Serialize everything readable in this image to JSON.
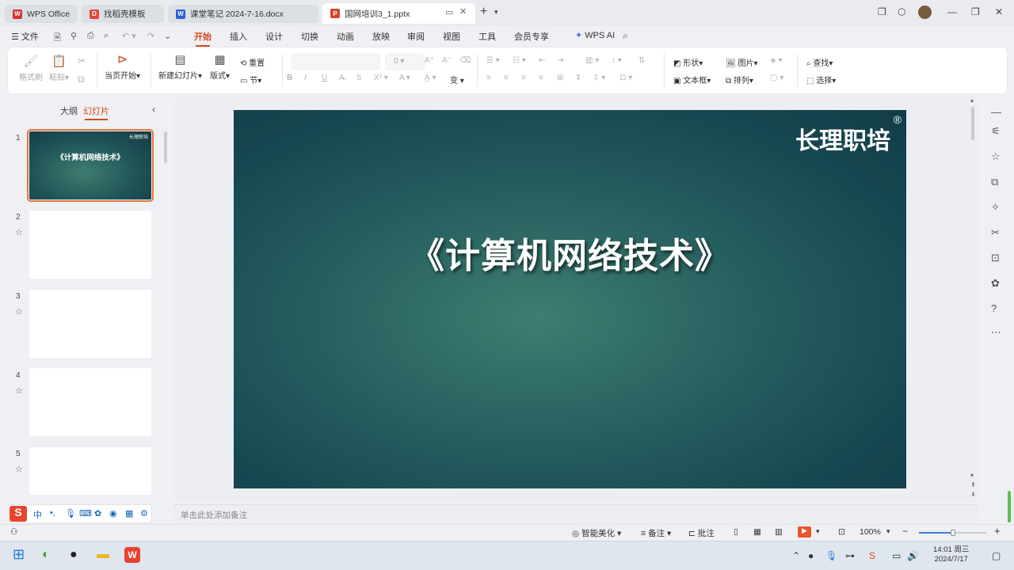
{
  "tabs": [
    {
      "label": "WPS Office",
      "icon": "wps-logo-icon",
      "color": "#d9342b"
    },
    {
      "label": "找稻壳模板",
      "icon": "docer-icon",
      "color": "#e0463a"
    },
    {
      "label": "课堂笔记 2024-7-16.docx",
      "icon": "word-doc-icon",
      "color": "#2b5fd9"
    },
    {
      "label": "国网培训3_1.pptx",
      "icon": "ppt-doc-icon",
      "color": "#d9472b"
    }
  ],
  "menu": {
    "file": "文件",
    "items": [
      "开始",
      "插入",
      "设计",
      "切换",
      "动画",
      "放映",
      "审阅",
      "视图",
      "工具",
      "会员专享"
    ],
    "active": "开始",
    "ai": "WPS AI"
  },
  "ribbon": {
    "format_painter": "格式刷",
    "paste": "粘贴",
    "play_from_current": "当页开始",
    "new_slide": "新建幻灯片",
    "layout": "版式",
    "reset": "重置",
    "section": "节",
    "font_size": "0",
    "shape": "形状",
    "picture": "图片",
    "textbox": "文本框",
    "arrange": "排列",
    "find": "查找",
    "select": "选择"
  },
  "left_panel": {
    "tab_outline": "大纲",
    "tab_slides": "幻灯片",
    "slides": [
      {
        "num": "1",
        "title": "《计算机网络技术》",
        "logo": "长理职培"
      },
      {
        "num": "2"
      },
      {
        "num": "3"
      },
      {
        "num": "4"
      },
      {
        "num": "5"
      }
    ]
  },
  "ime": {
    "lang": "中"
  },
  "slide": {
    "title": "《计算机网络技术》",
    "logo": "长理职培",
    "logo_mark": "®"
  },
  "notes_placeholder": "单击此处添加备注",
  "status": {
    "beautify": "智能美化",
    "notes": "备注",
    "comments": "批注",
    "zoom": "100%"
  },
  "taskbar": {
    "time": "14:01 周三",
    "date": "2024/7/17"
  }
}
